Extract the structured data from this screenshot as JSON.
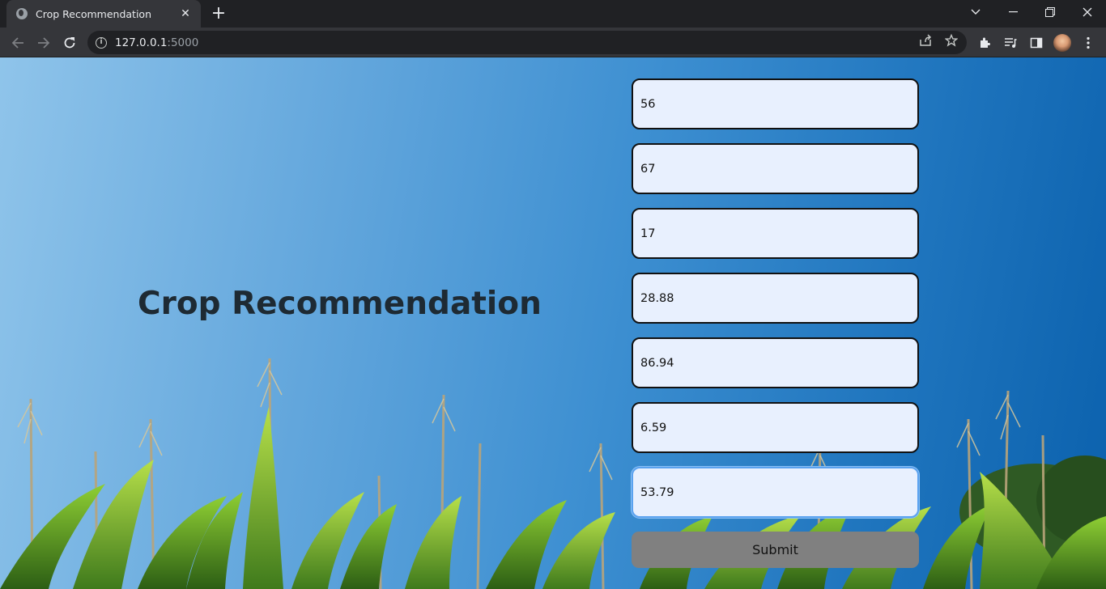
{
  "browser": {
    "tab_title": "Crop Recommendation",
    "tab_close": "✕",
    "new_tab": "+",
    "url_host": "127.0.0.1",
    "url_port": ":5000"
  },
  "page": {
    "heading": "Crop Recommendation",
    "inputs": [
      "56",
      "67",
      "17",
      "28.88",
      "86.94",
      "6.59",
      "53.79"
    ],
    "submit_label": "Submit"
  }
}
